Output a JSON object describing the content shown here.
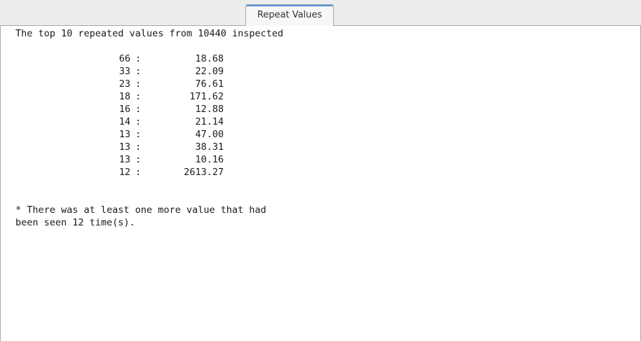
{
  "tab": {
    "label": "Repeat Values"
  },
  "report": {
    "header": "The top 10 repeated values from 10440 inspected",
    "separator": ":",
    "rows": [
      {
        "count": "66",
        "value": "18.68"
      },
      {
        "count": "33",
        "value": "22.09"
      },
      {
        "count": "23",
        "value": "76.61"
      },
      {
        "count": "18",
        "value": "171.62"
      },
      {
        "count": "16",
        "value": "12.88"
      },
      {
        "count": "14",
        "value": "21.14"
      },
      {
        "count": "13",
        "value": "47.00"
      },
      {
        "count": "13",
        "value": "38.31"
      },
      {
        "count": "13",
        "value": "10.16"
      },
      {
        "count": "12",
        "value": "2613.27"
      }
    ],
    "footnote_line1": "* There was at least one more value that had",
    "footnote_line2": "been seen 12 time(s)."
  }
}
